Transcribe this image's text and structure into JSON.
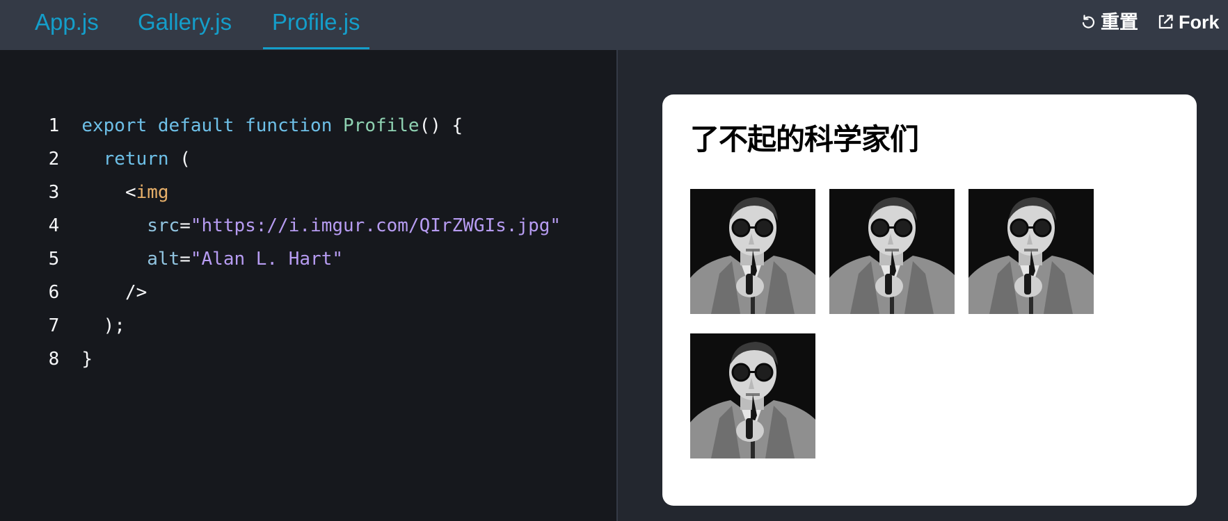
{
  "tabs": [
    {
      "label": "App.js",
      "active": false
    },
    {
      "label": "Gallery.js",
      "active": false
    },
    {
      "label": "Profile.js",
      "active": true
    }
  ],
  "actions": {
    "reset_label": "重置",
    "fork_label": "Fork"
  },
  "editor": {
    "line_numbers": [
      "1",
      "2",
      "3",
      "4",
      "5",
      "6",
      "7",
      "8"
    ],
    "tokens": {
      "l1_export": "export",
      "l1_default": "default",
      "l1_function": "function",
      "l1_name": "Profile",
      "l1_rest": "() {",
      "l2_return": "return",
      "l2_paren": "(",
      "l3_lt": "<",
      "l3_img": "img",
      "l4_attr": "src",
      "l4_eq": "=",
      "l4_val": "\"https://i.imgur.com/QIrZWGIs.jpg\"",
      "l5_attr": "alt",
      "l5_eq": "=",
      "l5_val": "\"Alan L. Hart\"",
      "l6": "/>",
      "l7": ");",
      "l8": "}"
    }
  },
  "preview": {
    "heading": "了不起的科学家们",
    "images": [
      {
        "alt": "Alan L. Hart"
      },
      {
        "alt": "Alan L. Hart"
      },
      {
        "alt": "Alan L. Hart"
      },
      {
        "alt": "Alan L. Hart"
      }
    ]
  },
  "colors": {
    "accent": "#149eca",
    "toolbar_bg": "#343a46",
    "editor_bg": "#16181d",
    "preview_bg": "#23272f"
  }
}
